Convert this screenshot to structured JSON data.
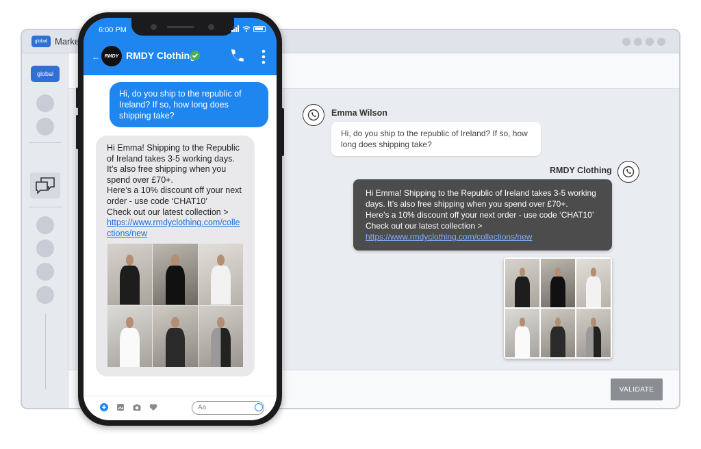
{
  "window": {
    "title": "Market",
    "logo_text": "global"
  },
  "sidebar": {
    "logo_text": "global"
  },
  "desktop_chat": {
    "customer_name": "Emma Wilson",
    "customer_message": "Hi, do you ship to the republic of Ireland? If so, how long does shipping take?",
    "business_name": "RMDY Clothing",
    "reply_lines": [
      "Hi Emma! Shipping to the Republic of Ireland takes 3-5 working days. It’s also free shipping when you spend over £70+.",
      "Here’s a 10% discount off your next order - use code ‘CHAT10’",
      "Check out our latest collection >"
    ],
    "reply_link": "https://www.rmdyclothing.com/collections/new"
  },
  "validate_label": "VALIDATE",
  "phone": {
    "time": "6:00 PM",
    "contact_name": "RMDY Clothing",
    "avatar_text": "RMDY",
    "outgoing_message": "Hi, do you ship to the republic of Ireland? If so, how long does shipping take?",
    "incoming_lines": [
      "Hi Emma! Shipping to the Republic of Ireland takes 3-5 working days.",
      "It’s also free shipping when you spend over £70+.",
      "Here’s a 10% discount off your next order - use code ‘CHAT10’",
      "Check out our latest collection >"
    ],
    "incoming_link": "https://www.rmdyclothing.com/collections/new",
    "input_placeholder": "Aa"
  },
  "icons": [
    "back-icon",
    "verified-icon",
    "phone-icon",
    "more-icon",
    "whatsapp-icon",
    "chat-icon",
    "plus-icon",
    "image-icon",
    "camera-icon",
    "heart-icon",
    "smile-icon"
  ],
  "colors": {
    "accent": "#1f86f0",
    "reply_bubble": "#4c4c4c",
    "validate_button": "#8a8d92",
    "verified": "#4caf50"
  }
}
